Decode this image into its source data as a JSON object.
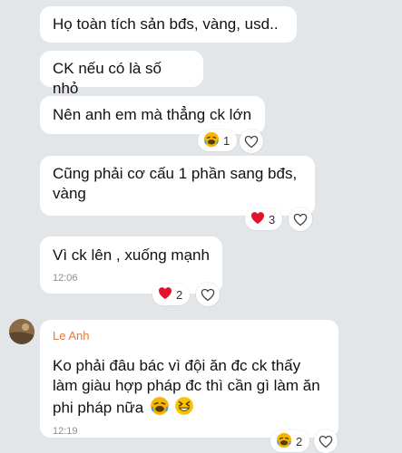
{
  "messages": [
    {
      "text": "Họ toàn tích sản bđs, vàng, usd.."
    },
    {
      "text": "CK nếu có là số nhỏ"
    },
    {
      "text": "Nên anh em mà thẳng ck lớn",
      "reaction": {
        "emoji": "laughing-crying-face",
        "count": "1"
      }
    },
    {
      "text_line1": "Cũng phải cơ cấu 1 phần sang bđs,",
      "text_line2": "vàng",
      "reaction": {
        "emoji": "red-heart",
        "count": "3"
      }
    },
    {
      "text": "Vì ck lên , xuống mạnh",
      "time": "12:06",
      "reaction": {
        "emoji": "red-heart",
        "count": "2"
      }
    },
    {
      "sender": "Le Anh",
      "text_line1": "Ko phải đâu bác vì đội ăn đc ck thấy",
      "text_line2": "làm giàu hợp pháp đc thì cần gì làm ăn",
      "text_line3": "phi pháp nữa",
      "time": "12:19",
      "reaction": {
        "emoji": "laughing-crying-face",
        "count": "2"
      }
    }
  ],
  "icons": {
    "heart_outline": "heart-outline-icon",
    "red_heart": "red-heart",
    "laughing": "laughing-crying-face",
    "grinning": "grinning-squinting-face"
  },
  "colors": {
    "background": "#e3e6e9",
    "bubble": "#ffffff",
    "sender": "#e07a3a",
    "heart": "#e0142b",
    "time": "#8a8f96"
  }
}
